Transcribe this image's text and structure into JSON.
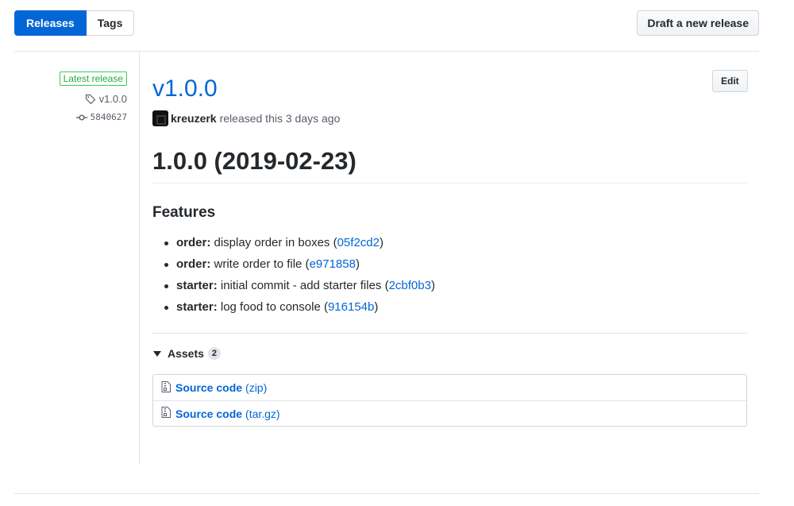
{
  "tabs": [
    {
      "label": "Releases",
      "active": true
    },
    {
      "label": "Tags",
      "active": false
    }
  ],
  "draft_button": "Draft a new release",
  "sidebar": {
    "latest_label": "Latest release",
    "tag": "v1.0.0",
    "tag_icon": "tag-icon",
    "commit": "5840627",
    "commit_icon": "commit-icon"
  },
  "release": {
    "title": "v1.0.0",
    "edit_label": "Edit",
    "author": "kreuzerk",
    "byline_text": "released this 3 days ago",
    "heading": "1.0.0 (2019-02-23)",
    "features_heading": "Features",
    "features": [
      {
        "scope": "order:",
        "text": " display order in boxes (",
        "hash": "05f2cd2",
        "close": ")"
      },
      {
        "scope": "order:",
        "text": " write order to file (",
        "hash": "e971858",
        "close": ")"
      },
      {
        "scope": "starter:",
        "text": " initial commit - add starter files (",
        "hash": "2cbf0b3",
        "close": ")"
      },
      {
        "scope": "starter:",
        "text": " log food to console (",
        "hash": "916154b",
        "close": ")"
      }
    ]
  },
  "assets": {
    "label": "Assets",
    "count": "2",
    "items": [
      {
        "name": "Source code",
        "ext": "(zip)",
        "icon": "file-zip-icon"
      },
      {
        "name": "Source code",
        "ext": "(tar.gz)",
        "icon": "file-zip-icon"
      }
    ]
  },
  "colors": {
    "accent": "#0366d6",
    "success": "#28a745",
    "text": "#24292e",
    "muted": "#586069"
  }
}
